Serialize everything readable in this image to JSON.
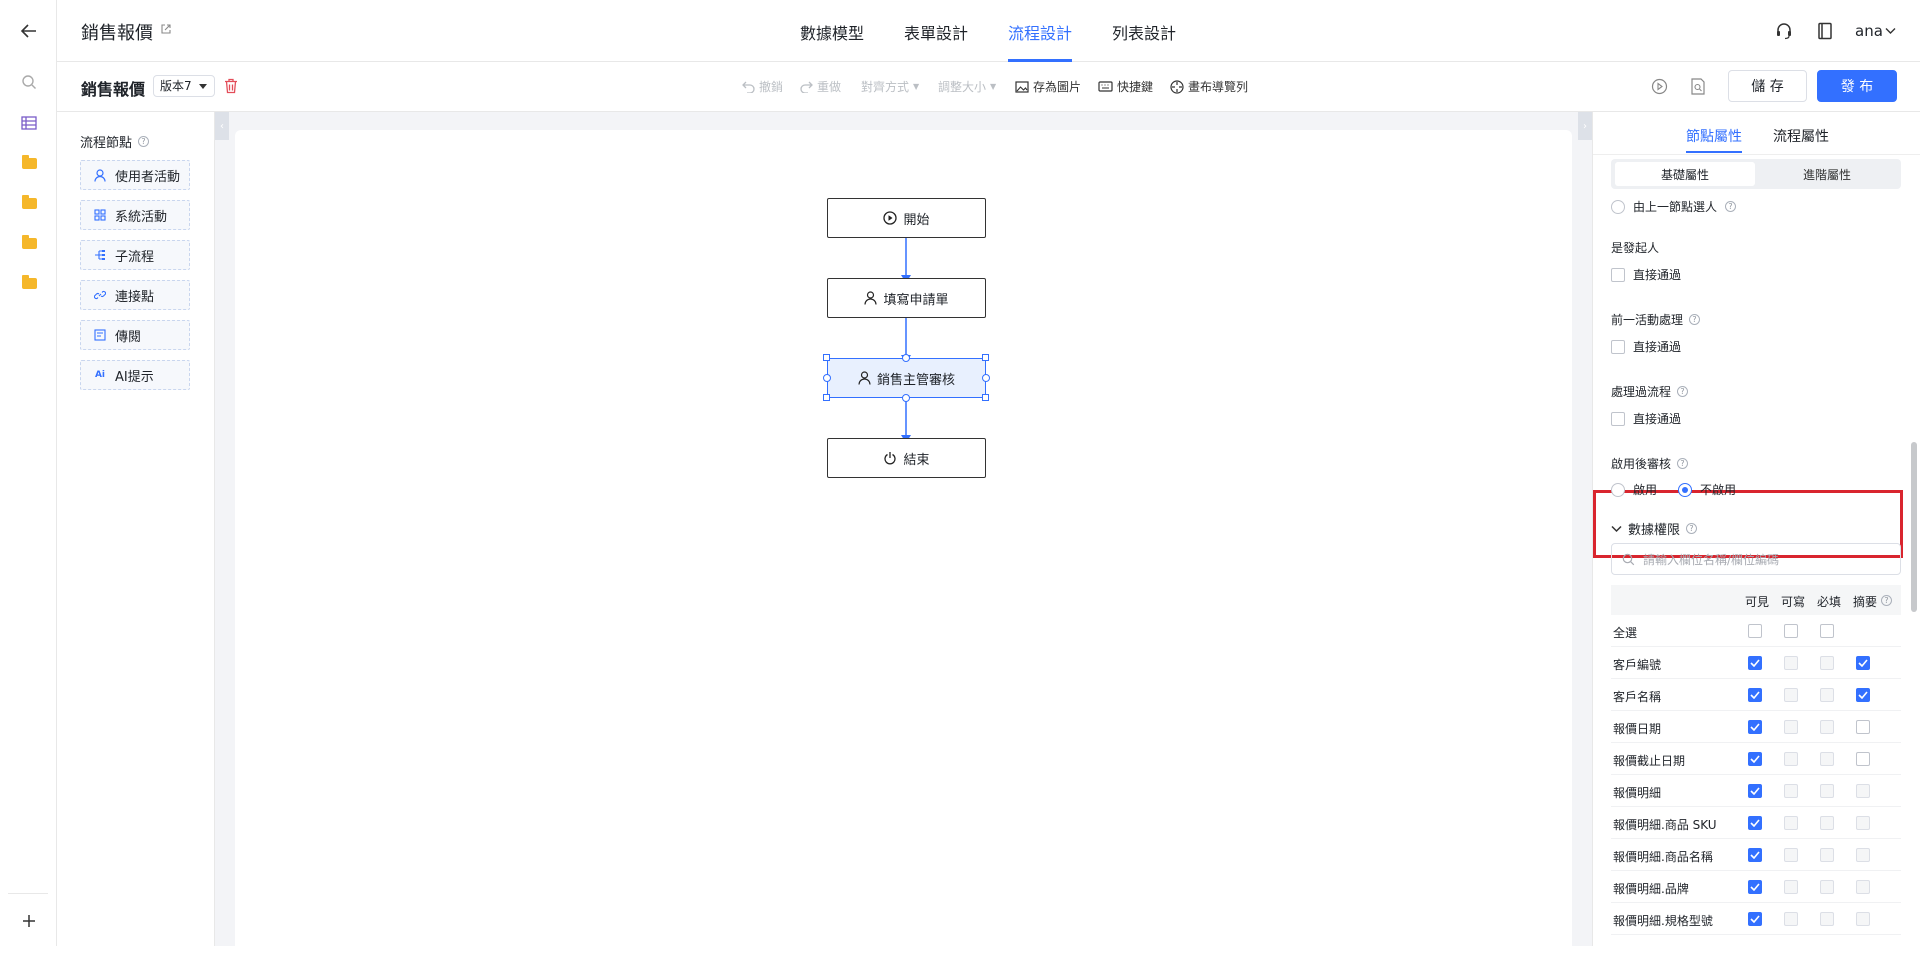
{
  "header": {
    "app_title": "銷售報價",
    "tabs": [
      {
        "label": "數據模型"
      },
      {
        "label": "表單設計"
      },
      {
        "label": "流程設計"
      },
      {
        "label": "列表設計"
      }
    ],
    "user": "ana"
  },
  "toolbar": {
    "flow_title": "銷售報價",
    "version": "版本7",
    "undo": "撤銷",
    "redo": "重做",
    "align": "對齊方式",
    "resize": "調整大小",
    "save_image": "存為圖片",
    "shortcuts": "快捷鍵",
    "canvas_nav": "畫布導覽列",
    "save_label": "儲 存",
    "publish_label": "發 布"
  },
  "palette": {
    "title": "流程節點",
    "items": [
      {
        "label": "使用者活動"
      },
      {
        "label": "系統活動"
      },
      {
        "label": "子流程"
      },
      {
        "label": "連接點"
      },
      {
        "label": "傳閱"
      },
      {
        "label": "AI提示"
      }
    ]
  },
  "flow": {
    "nodes": [
      {
        "label": "開始"
      },
      {
        "label": "填寫申請單"
      },
      {
        "label": "銷售主管審核"
      },
      {
        "label": "結束"
      }
    ]
  },
  "panel": {
    "tabs": [
      {
        "label": "節點屬性"
      },
      {
        "label": "流程屬性"
      }
    ],
    "segments": [
      {
        "label": "基礎屬性"
      },
      {
        "label": "進階屬性"
      }
    ],
    "prev_node_option": "由上一節點選人",
    "is_initiator": {
      "label": "是發起人",
      "option": "直接通過"
    },
    "prev_activity": {
      "label": "前一活動處理",
      "option": "直接通過"
    },
    "processed": {
      "label": "處理過流程",
      "option": "直接通過"
    },
    "post_review": {
      "label": "啟用後審核",
      "enable": "啟用",
      "disable": "不啟用",
      "selected": "不啟用"
    },
    "data_perm": {
      "label": "數據權限",
      "search_placeholder": "請輸入欄位名稱/欄位編碼",
      "columns": [
        "可見",
        "可寫",
        "必填",
        "摘要"
      ],
      "rows": [
        {
          "name": "全選",
          "visible": false,
          "write": false,
          "required": false,
          "summary": null
        },
        {
          "name": "客戶編號",
          "visible": true,
          "write": false,
          "required": false,
          "summary": true
        },
        {
          "name": "客戶名稱",
          "visible": true,
          "write": false,
          "required": false,
          "summary": true
        },
        {
          "name": "報價日期",
          "visible": true,
          "write": false,
          "required": false,
          "summary": false
        },
        {
          "name": "報價截止日期",
          "visible": true,
          "write": false,
          "required": false,
          "summary": false
        },
        {
          "name": "報價明細",
          "visible": true,
          "write": false,
          "required": false,
          "summary": false
        },
        {
          "name": "報價明細.商品 SKU",
          "visible": true,
          "write": false,
          "required": false,
          "summary": false
        },
        {
          "name": "報價明細.商品名稱",
          "visible": true,
          "write": false,
          "required": false,
          "summary": false
        },
        {
          "name": "報價明細.品牌",
          "visible": true,
          "write": false,
          "required": false,
          "summary": false
        },
        {
          "name": "報價明細.規格型號",
          "visible": true,
          "write": false,
          "required": false,
          "summary": false
        }
      ]
    }
  },
  "colors": {
    "accent": "#3370ff",
    "highlight": "#d9252e",
    "folder": "#f5b72a"
  }
}
